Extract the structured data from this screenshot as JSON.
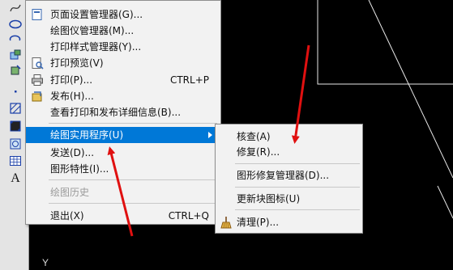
{
  "menu": {
    "items": [
      {
        "label": "页面设置管理器(G)...",
        "shortcut": "",
        "icon": "page-setup-icon"
      },
      {
        "label": "绘图仪管理器(M)...",
        "shortcut": ""
      },
      {
        "label": "打印样式管理器(Y)...",
        "shortcut": ""
      },
      {
        "label": "打印预览(V)",
        "shortcut": "",
        "icon": "preview-icon"
      },
      {
        "label": "打印(P)...",
        "shortcut": "CTRL+P",
        "icon": "printer-icon"
      },
      {
        "label": "发布(H)...",
        "shortcut": "",
        "icon": "publish-icon"
      },
      {
        "label": "查看打印和发布详细信息(B)...",
        "shortcut": ""
      },
      {
        "label": "绘图实用程序(U)",
        "shortcut": ""
      },
      {
        "label": "发送(D)...",
        "shortcut": ""
      },
      {
        "label": "图形特性(I)...",
        "shortcut": ""
      },
      {
        "label": "绘图历史",
        "shortcut": ""
      },
      {
        "label": "退出(X)",
        "shortcut": "CTRL+Q"
      }
    ]
  },
  "submenu": {
    "items": [
      {
        "label": "核查(A)"
      },
      {
        "label": "修复(R)..."
      },
      {
        "label": "图形修复管理器(D)..."
      },
      {
        "label": "更新块图标(U)"
      },
      {
        "label": "清理(P)...",
        "icon": "purge-icon"
      }
    ]
  },
  "canvas": {
    "ucs_label": "Y"
  },
  "colors": {
    "highlight": "#0078d7",
    "annotation_arrow": "#e01010",
    "drawing_bg": "#000000"
  }
}
